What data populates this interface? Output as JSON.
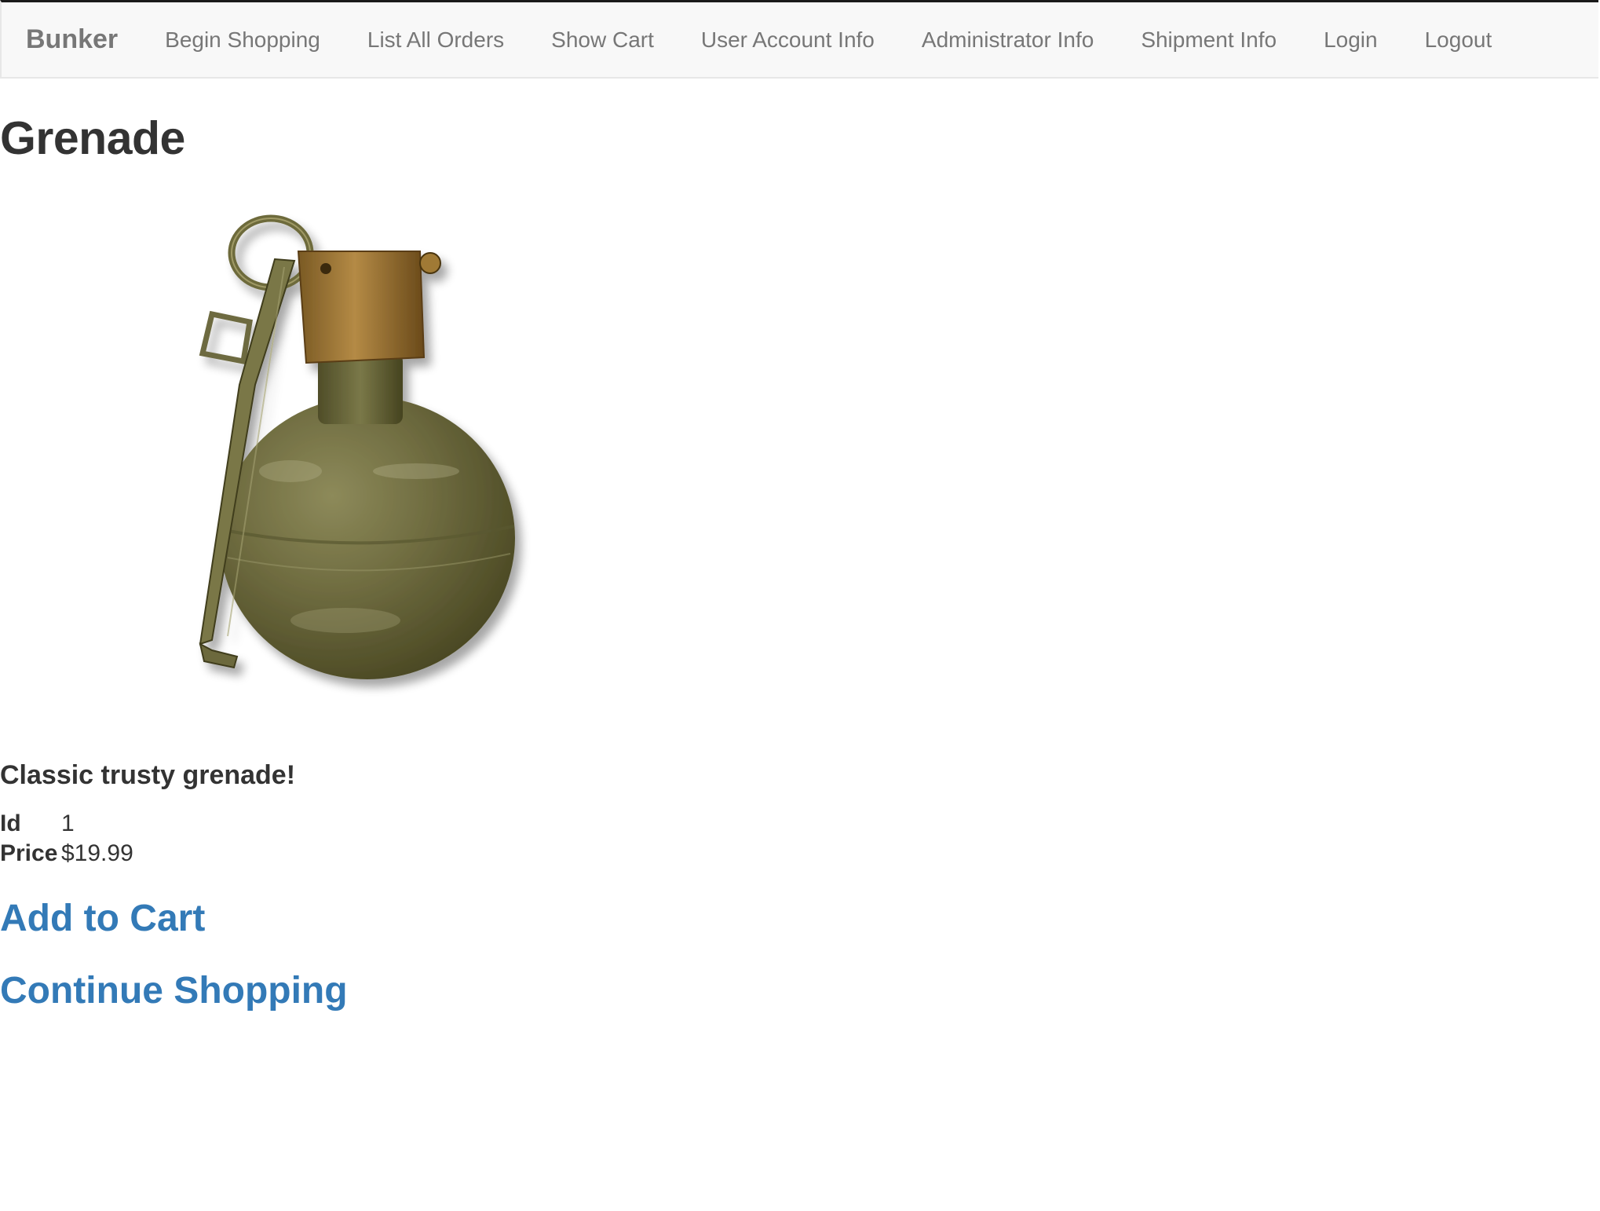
{
  "navbar": {
    "brand": "Bunker",
    "items": [
      {
        "label": "Begin Shopping"
      },
      {
        "label": "List All Orders"
      },
      {
        "label": "Show Cart"
      },
      {
        "label": "User Account Info"
      },
      {
        "label": "Administrator Info"
      },
      {
        "label": "Shipment Info"
      },
      {
        "label": "Login"
      },
      {
        "label": "Logout"
      }
    ]
  },
  "product": {
    "title": "Grenade",
    "image_icon": "grenade-image",
    "description": "Classic trusty grenade!",
    "id_label": "Id",
    "id_value": "1",
    "price_label": "Price",
    "price_value": "$19.99"
  },
  "actions": {
    "add_to_cart": "Add to Cart",
    "continue_shopping": "Continue Shopping"
  },
  "colors": {
    "link": "#337ab7",
    "navbar_bg": "#f8f8f8",
    "nav_text": "#777777",
    "text": "#333333",
    "grenade_olive": "#6b6a3c",
    "grenade_brass": "#9c7a3c"
  }
}
